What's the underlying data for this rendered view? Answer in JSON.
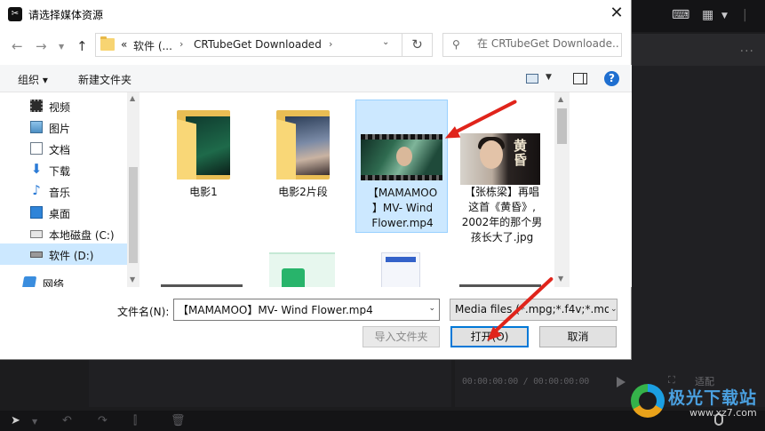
{
  "background_app": {
    "timecode": "00:00:00:00 / 00:00:00:00",
    "preview_ctrl_label": "适配",
    "more_label": "...",
    "watermark": {
      "name": "极光下载站",
      "url": "www.xz7.com"
    }
  },
  "dialog": {
    "title": "请选择媒体资源",
    "close_label": "✕",
    "address": {
      "overflow": "«",
      "segments": [
        "软件 (...",
        "CRTubeGet Downloaded"
      ],
      "separator": "›"
    },
    "search_placeholder": "在 CRTubeGet Downloade...",
    "toolbar": {
      "organize": "组织 ▾",
      "new_folder": "新建文件夹",
      "help": "?"
    },
    "nav_items": [
      {
        "label": "视频",
        "icon": "video-folder-icon"
      },
      {
        "label": "图片",
        "icon": "pictures-folder-icon"
      },
      {
        "label": "文档",
        "icon": "documents-folder-icon"
      },
      {
        "label": "下载",
        "icon": "downloads-folder-icon"
      },
      {
        "label": "音乐",
        "icon": "music-folder-icon"
      },
      {
        "label": "桌面",
        "icon": "desktop-folder-icon"
      },
      {
        "label": "本地磁盘 (C:)",
        "icon": "drive-c-icon"
      },
      {
        "label": "软件 (D:)",
        "icon": "drive-d-icon"
      },
      {
        "label": "网络",
        "icon": "network-icon"
      }
    ],
    "files": [
      {
        "caption": "电影1",
        "type": "folder"
      },
      {
        "caption": "电影2片段",
        "type": "folder"
      },
      {
        "caption": "【MAMAMOO】MV- Wind Flower.mp4",
        "lines": [
          "【MAMAMOO",
          "】MV- Wind",
          "Flower.mp4"
        ],
        "type": "video",
        "selected": true
      },
      {
        "caption": "【张栋梁】再唱这首《黄昏》，2002年的那个男孩长大了.jpg",
        "lines": [
          "【张栋梁】再唱",
          "这首《黄昏》,",
          "2002年的那个男",
          "孩长大了.jpg"
        ],
        "type": "image",
        "thumb_text": "黄\n昏"
      }
    ],
    "filename_label": "文件名(N):",
    "filename_value": "【MAMAMOO】MV- Wind Flower.mp4",
    "filter_value": "Media files (*.mpg;*.f4v;*.mo",
    "buttons": {
      "import_folder": "导入文件夹",
      "open": "打开(O)",
      "cancel": "取消"
    }
  },
  "colors": {
    "selection": "#cce8ff",
    "accent": "#0078d7",
    "annotation_arrow": "#e0241b",
    "dark_bg": "#1c1c1e"
  }
}
